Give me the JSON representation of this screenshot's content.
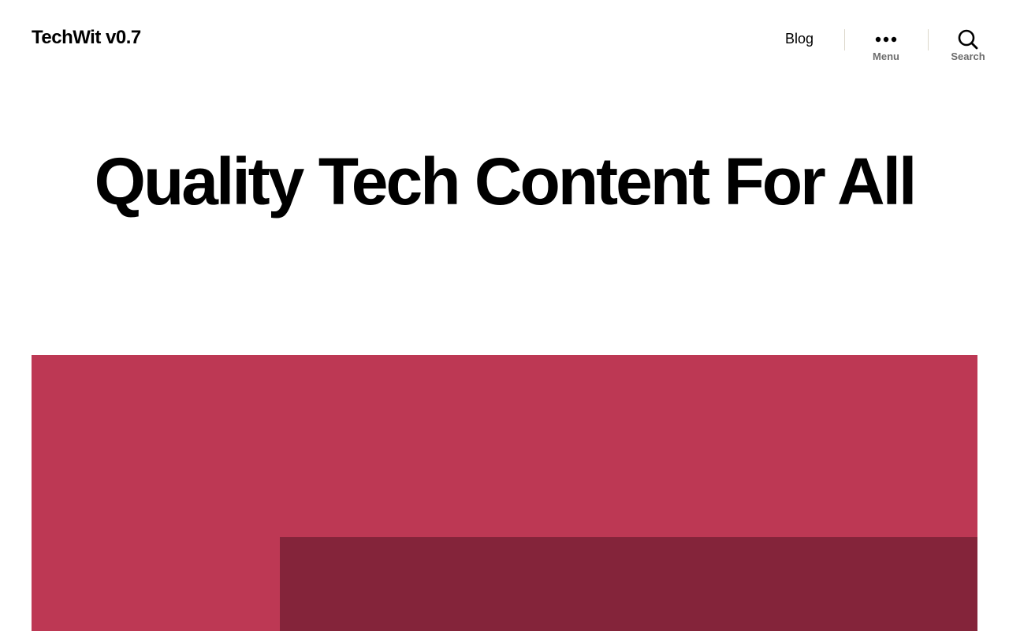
{
  "site": {
    "title": "TechWit v0.7"
  },
  "nav": {
    "blog_label": "Blog",
    "menu_label": "Menu",
    "search_label": "Search",
    "menu_icon": "ellipsis-icon",
    "search_icon": "search-icon"
  },
  "hero": {
    "title": "Quality Tech Content For All"
  },
  "featured_image": {
    "background_color": "#bd3854",
    "panel_color": "#84243a"
  }
}
